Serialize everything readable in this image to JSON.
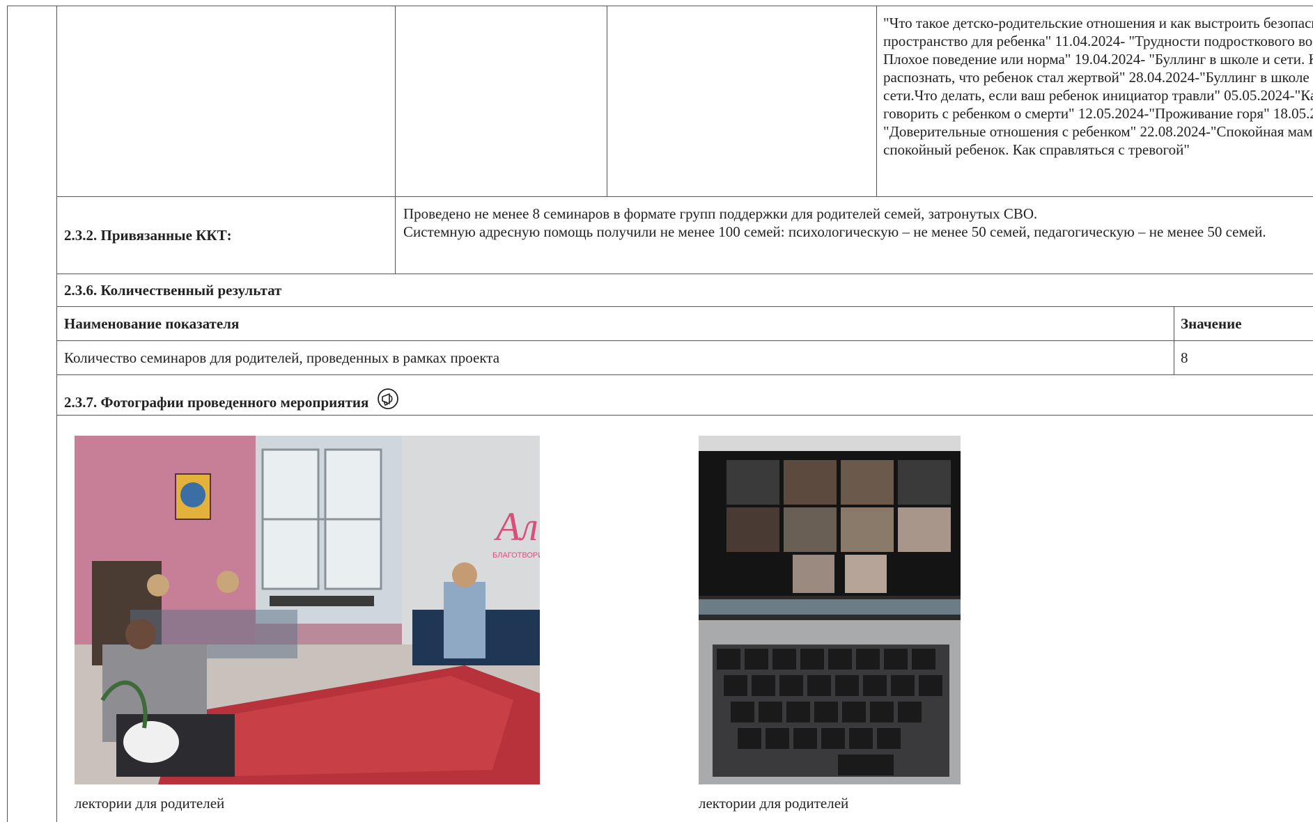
{
  "topics_text": "\"Что такое детско-родительские отношения и как выстроить безопасное пространство для ребенка\" 11.04.2024- \"Трудности подросткового возраста. Плохое поведение или норма\" 19.04.2024- \"Буллинг в школе и сети. Как распознать, что ребенок стал жертвой\" 28.04.2024-\"Буллинг в школе и сети.Что делать, если ваш ребенок инициатор травли\" 05.05.2024-\"Как говорить с ребенком о смерти\" 12.05.2024-\"Проживание горя\" 18.05.2024-\"Доверительные отношения с ребенком\" 22.08.2024-\"Спокойная мама-спокойный ребенок. Как справляться с тревогой\"",
  "kkt": {
    "label": "2.3.2. Привязанные ККТ:",
    "line1": "Проведено не менее 8 семинаров в формате групп поддержки для родителей семей, затронутых СВО.",
    "line2": "Системную адресную помощь получили не менее 100 семей: психологическую – не менее 50 семей, педагогическую – не менее 50 семей."
  },
  "quant": {
    "heading": "2.3.6. Количественный результат",
    "col_name": "Наименование показателя",
    "col_value": "Значение",
    "rows": [
      {
        "name": "Количество семинаров для родителей, проведенных в рамках проекта",
        "value": "8"
      }
    ]
  },
  "photos": {
    "heading": "2.3.7. Фотографии проведенного мероприятия",
    "heading_icon": "megaphone-icon",
    "items": [
      {
        "caption": "лектории для родителей",
        "brand_text": "Ал",
        "brand_sub": "БЛАГОТВОРИ"
      },
      {
        "caption": "лектории для родителей"
      }
    ]
  }
}
